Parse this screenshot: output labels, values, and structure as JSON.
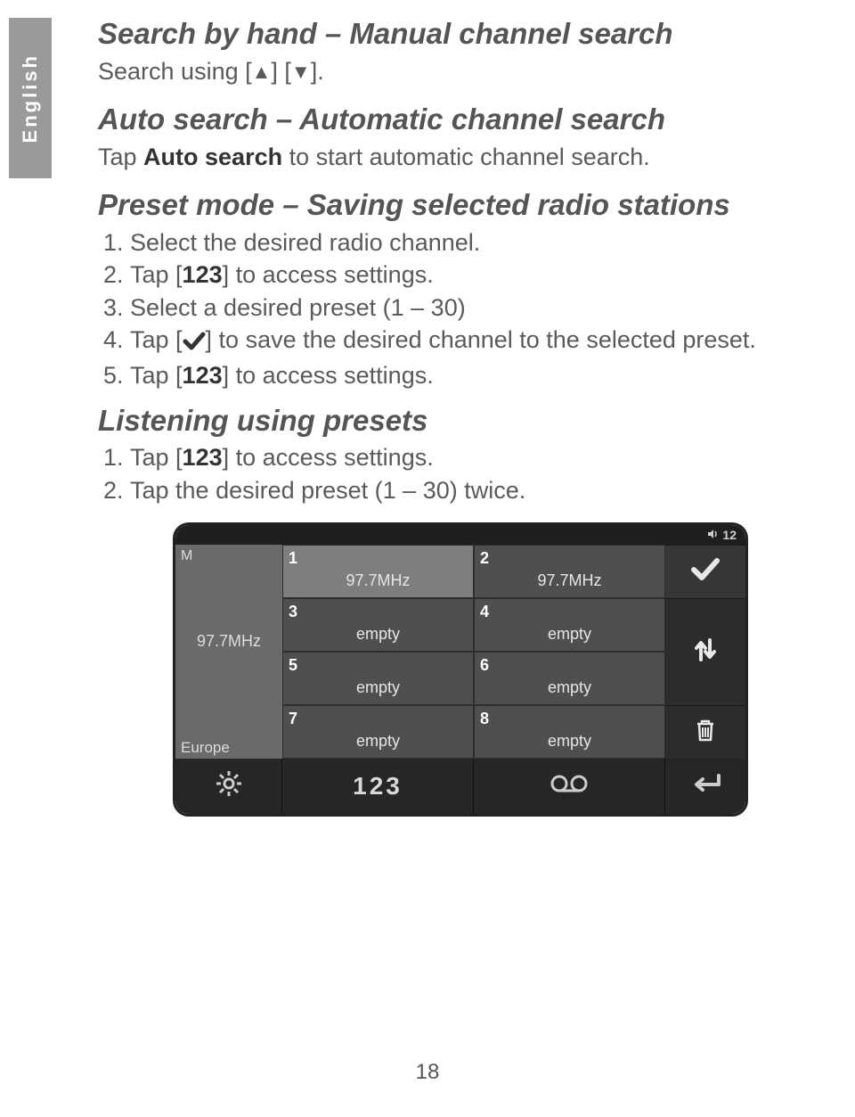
{
  "languageTab": "English",
  "pageNumber": "18",
  "section1": {
    "heading": "Search by hand – Manual channel search",
    "line_a": "Search using [",
    "line_b": "] [",
    "line_c": "]."
  },
  "section2": {
    "heading": "Auto search – Automatic channel search",
    "line_a": "Tap ",
    "line_bold": "Auto search",
    "line_b": " to start automatic channel search."
  },
  "section3": {
    "heading": "Preset mode – Saving selected radio stations",
    "steps": {
      "s1": "Select the desired radio channel.",
      "s2a": "Tap [",
      "s2bold": "123",
      "s2b": "] to access settings.",
      "s3": "Select a desired preset (1 – 30)",
      "s4a": "Tap [",
      "s4b": "] to save the desired channel to the selected preset.",
      "s5a": "Tap [",
      "s5bold": "123",
      "s5b": "] to access settings."
    }
  },
  "section4": {
    "heading": "Listening using presets",
    "steps": {
      "s1a": "Tap [",
      "s1bold": "123",
      "s1b": "] to access settings.",
      "s2": "Tap the desired preset (1 – 30) twice."
    }
  },
  "screenshot": {
    "volumeValue": "12",
    "leftM": "M",
    "leftFreq": "97.7MHz",
    "leftRegion": "Europe",
    "presets": [
      {
        "n": "1",
        "v": "97.7MHz"
      },
      {
        "n": "2",
        "v": "97.7MHz"
      },
      {
        "n": "3",
        "v": "empty"
      },
      {
        "n": "4",
        "v": "empty"
      },
      {
        "n": "5",
        "v": "empty"
      },
      {
        "n": "6",
        "v": "empty"
      },
      {
        "n": "7",
        "v": "empty"
      },
      {
        "n": "8",
        "v": "empty"
      }
    ],
    "bottom123": "123"
  }
}
